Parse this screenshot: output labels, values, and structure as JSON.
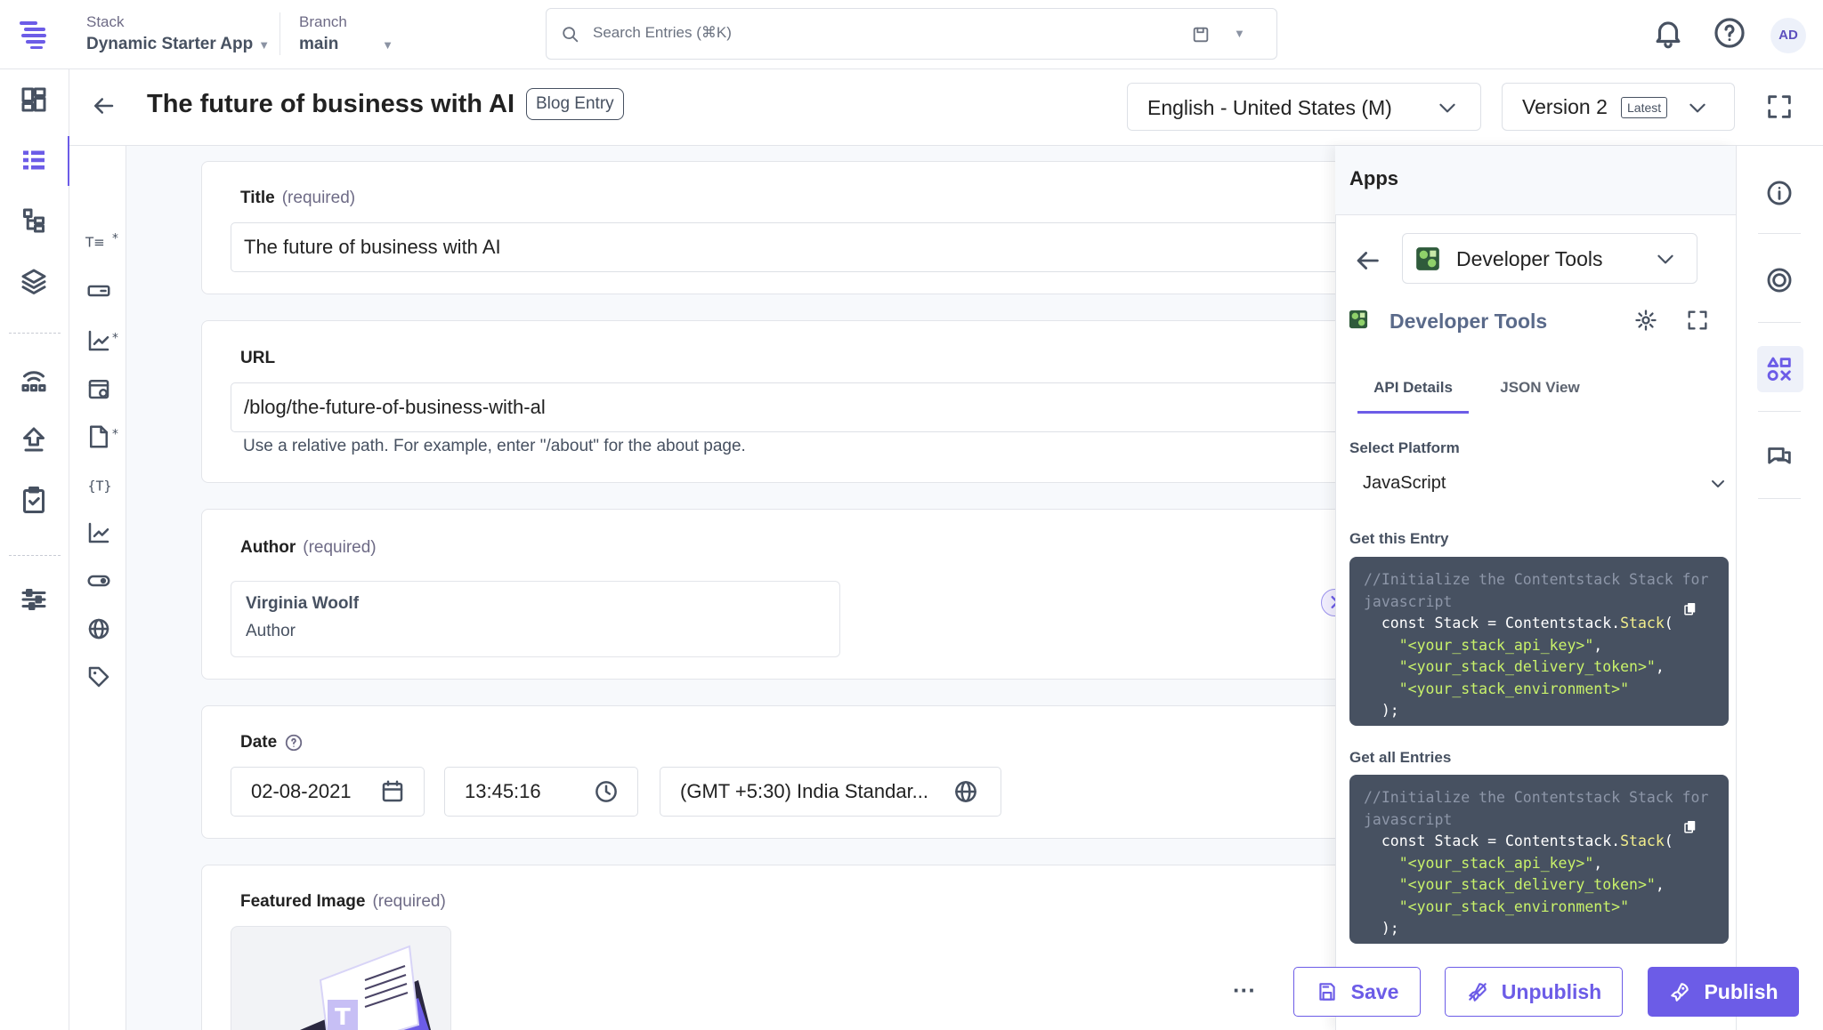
{
  "topbar": {
    "stack_label": "Stack",
    "stack_value": "Dynamic Starter App",
    "branch_label": "Branch",
    "branch_value": "main",
    "search_placeholder": "Search Entries (⌘K)",
    "avatar_initials": "AD"
  },
  "entry": {
    "title": "The future of business with AI",
    "content_type_badge": "Blog Entry",
    "locale": "English - United States (M)",
    "version": "Version 2",
    "version_tag": "Latest"
  },
  "fields": {
    "title_label": "Title",
    "title_req": "(required)",
    "title_value": "The future of business with AI",
    "url_label": "URL",
    "url_value": "/blog/the-future-of-business-with-al",
    "url_help": "Use a relative path. For example, enter \"/about\" for the about page.",
    "author_label": "Author",
    "author_req": "(required)",
    "author_name": "Virginia Woolf",
    "author_type": "Author",
    "date_label": "Date",
    "date_value": "02-08-2021",
    "time_value": "13:45:16",
    "timezone_value": "(GMT +5:30) India Standar...",
    "image_label": "Featured Image",
    "image_req": "(required)"
  },
  "apps_panel": {
    "header": "Apps",
    "app_selected": "Developer Tools",
    "app_title": "Developer Tools",
    "tabs": [
      "API Details",
      "JSON View"
    ],
    "active_tab": "API Details",
    "platform_label": "Select Platform",
    "platform_value": "JavaScript",
    "section1_label": "Get this Entry",
    "section2_label": "Get all Entries",
    "code": {
      "comment": "//Initialize the Contentstack Stack for javascript",
      "decl_kw": "const",
      "decl_var": " Stack = Contentstack.",
      "decl_fn": "Stack",
      "decl_open": "(",
      "arg1": "\"<your_stack_api_key>\"",
      "arg2": "\"<your_stack_delivery_token>\"",
      "arg3": "\"<your_stack_environment>\"",
      "close": ");"
    }
  },
  "footer": {
    "more": "···",
    "save": "Save",
    "unpublish": "Unpublish",
    "publish": "Publish"
  },
  "colors": {
    "accent": "#6c5ce7",
    "text_dark": "#222222",
    "text_muted": "#6e6b86",
    "code_bg": "#475161",
    "code_string": "#c9f26a"
  }
}
